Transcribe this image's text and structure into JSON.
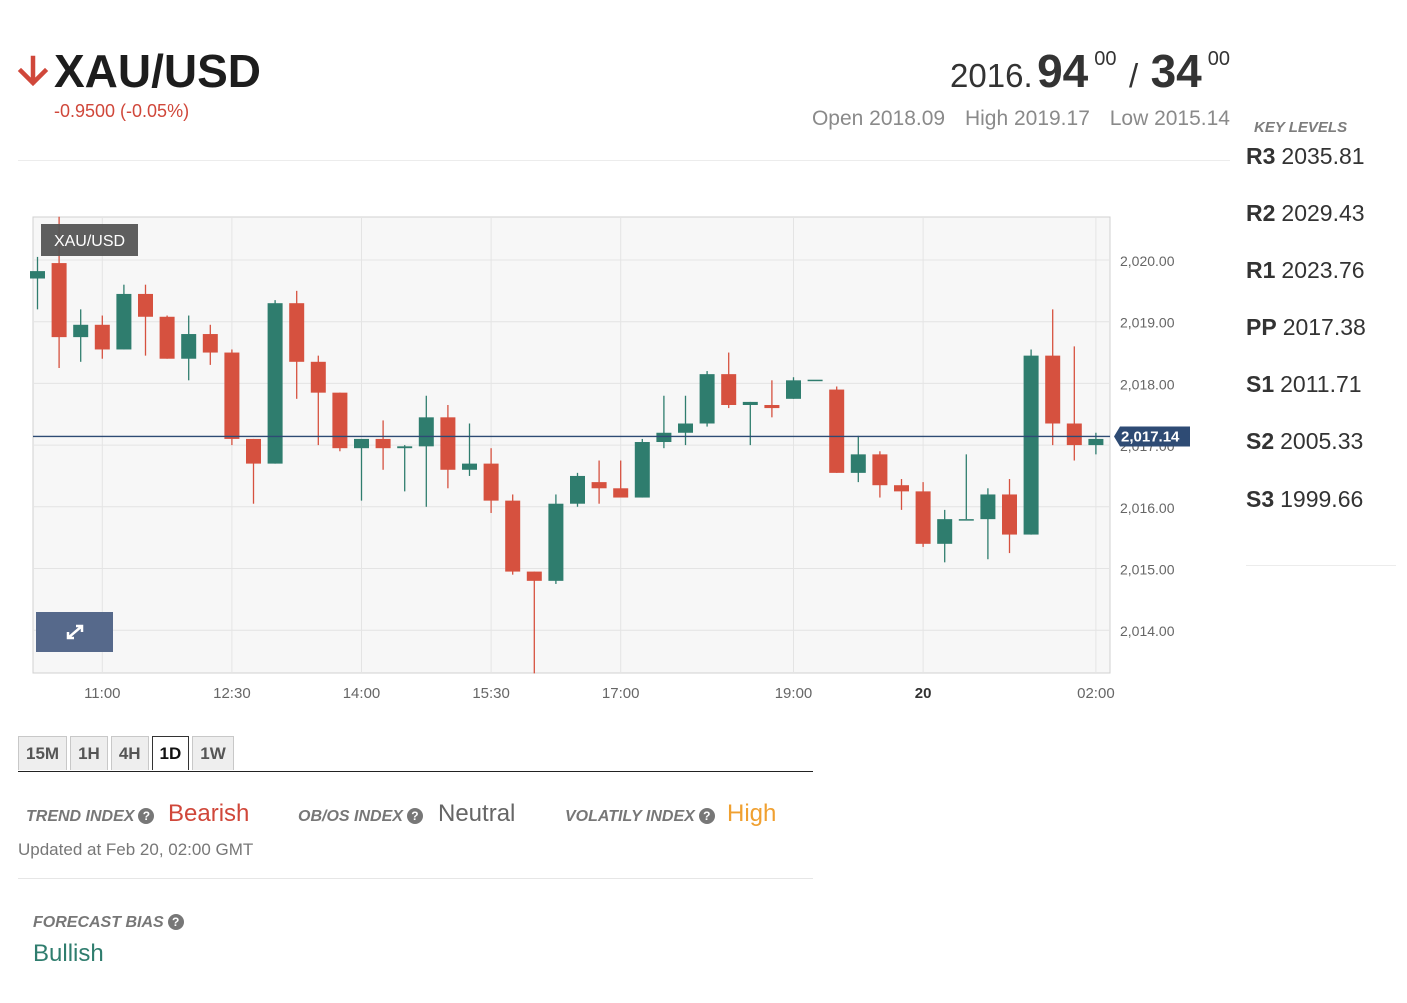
{
  "header": {
    "symbol": "XAU/USD",
    "direction_icon": "arrow-down-icon",
    "change": "-0.9500 (-0.05%)",
    "price_int": "2016.",
    "bid_main": "94",
    "bid_sup": "00",
    "sep": "/",
    "ask_main": "34",
    "ask_sup": "00",
    "open": "Open 2018.09",
    "high": "High 2019.17",
    "low": "Low 2015.14"
  },
  "key_levels": {
    "title": "KEY LEVELS",
    "levels": [
      {
        "name": "R3",
        "value": "2035.81"
      },
      {
        "name": "R2",
        "value": "2029.43"
      },
      {
        "name": "R1",
        "value": "2023.76"
      },
      {
        "name": "PP",
        "value": "2017.38"
      },
      {
        "name": "S1",
        "value": "2011.71"
      },
      {
        "name": "S2",
        "value": "2005.33"
      },
      {
        "name": "S3",
        "value": "1999.66"
      }
    ]
  },
  "colors": {
    "up": "#2f7d6e",
    "down": "#d6513f",
    "accent_red": "#d0473a",
    "neutral": "#555555",
    "high": "#f0a030",
    "price_tag": "#2e4b74"
  },
  "chart_data": {
    "type": "candlestick",
    "title": "XAU/USD",
    "ylim": [
      2013.3,
      2020.75
    ],
    "y_ticks": [
      "2,020.00",
      "2,019.00",
      "2,018.00",
      "2,017.00",
      "2,016.00",
      "2,015.00",
      "2,014.00"
    ],
    "y_tick_values": [
      2020,
      2019,
      2018,
      2017,
      2016,
      2015,
      2014
    ],
    "x_tick_labels": [
      "11:00",
      "12:30",
      "14:00",
      "15:30",
      "17:00",
      "19:00",
      "20",
      "02:00"
    ],
    "x_tick_index": [
      3,
      9,
      15,
      21,
      27,
      35,
      41,
      49
    ],
    "x_tick_bold": [
      false,
      false,
      false,
      false,
      false,
      false,
      true,
      false
    ],
    "current_price": 2017.14,
    "current_price_label": "2,017.14",
    "candles": [
      {
        "o": 2019.7,
        "h": 2020.05,
        "l": 2019.2,
        "c": 2019.82
      },
      {
        "o": 2019.95,
        "h": 2020.7,
        "l": 2018.25,
        "c": 2018.75
      },
      {
        "o": 2018.75,
        "h": 2019.2,
        "l": 2018.35,
        "c": 2018.95
      },
      {
        "o": 2018.95,
        "h": 2019.1,
        "l": 2018.4,
        "c": 2018.55
      },
      {
        "o": 2018.55,
        "h": 2019.6,
        "l": 2018.55,
        "c": 2019.45
      },
      {
        "o": 2019.45,
        "h": 2019.6,
        "l": 2018.45,
        "c": 2019.08
      },
      {
        "o": 2019.08,
        "h": 2019.1,
        "l": 2018.4,
        "c": 2018.4
      },
      {
        "o": 2018.4,
        "h": 2019.1,
        "l": 2018.05,
        "c": 2018.8
      },
      {
        "o": 2018.8,
        "h": 2018.95,
        "l": 2018.3,
        "c": 2018.5
      },
      {
        "o": 2018.5,
        "h": 2018.55,
        "l": 2017.0,
        "c": 2017.1
      },
      {
        "o": 2017.1,
        "h": 2017.1,
        "l": 2016.05,
        "c": 2016.7
      },
      {
        "o": 2016.7,
        "h": 2019.35,
        "l": 2016.7,
        "c": 2019.3
      },
      {
        "o": 2019.3,
        "h": 2019.5,
        "l": 2017.75,
        "c": 2018.35
      },
      {
        "o": 2018.35,
        "h": 2018.45,
        "l": 2017.0,
        "c": 2017.85
      },
      {
        "o": 2017.85,
        "h": 2017.85,
        "l": 2016.9,
        "c": 2016.95
      },
      {
        "o": 2016.95,
        "h": 2017.1,
        "l": 2016.1,
        "c": 2017.1
      },
      {
        "o": 2017.1,
        "h": 2017.4,
        "l": 2016.6,
        "c": 2016.95
      },
      {
        "o": 2016.95,
        "h": 2017.0,
        "l": 2016.25,
        "c": 2016.98
      },
      {
        "o": 2016.98,
        "h": 2017.8,
        "l": 2016.0,
        "c": 2017.45
      },
      {
        "o": 2017.45,
        "h": 2017.65,
        "l": 2016.3,
        "c": 2016.6
      },
      {
        "o": 2016.6,
        "h": 2017.35,
        "l": 2016.5,
        "c": 2016.7
      },
      {
        "o": 2016.7,
        "h": 2016.95,
        "l": 2015.9,
        "c": 2016.1
      },
      {
        "o": 2016.1,
        "h": 2016.2,
        "l": 2014.9,
        "c": 2014.95
      },
      {
        "o": 2014.95,
        "h": 2014.95,
        "l": 2013.3,
        "c": 2014.8
      },
      {
        "o": 2014.8,
        "h": 2016.2,
        "l": 2014.75,
        "c": 2016.05
      },
      {
        "o": 2016.05,
        "h": 2016.55,
        "l": 2016.0,
        "c": 2016.5
      },
      {
        "o": 2016.4,
        "h": 2016.75,
        "l": 2016.05,
        "c": 2016.3
      },
      {
        "o": 2016.3,
        "h": 2016.75,
        "l": 2016.2,
        "c": 2016.15
      },
      {
        "o": 2016.15,
        "h": 2017.1,
        "l": 2016.15,
        "c": 2017.05
      },
      {
        "o": 2017.05,
        "h": 2017.8,
        "l": 2016.95,
        "c": 2017.2
      },
      {
        "o": 2017.2,
        "h": 2017.8,
        "l": 2017.0,
        "c": 2017.35
      },
      {
        "o": 2017.35,
        "h": 2018.2,
        "l": 2017.3,
        "c": 2018.15
      },
      {
        "o": 2018.15,
        "h": 2018.5,
        "l": 2017.6,
        "c": 2017.65
      },
      {
        "o": 2017.65,
        "h": 2017.7,
        "l": 2017.0,
        "c": 2017.7
      },
      {
        "o": 2017.65,
        "h": 2018.05,
        "l": 2017.45,
        "c": 2017.6
      },
      {
        "o": 2017.75,
        "h": 2018.1,
        "l": 2017.75,
        "c": 2018.05
      },
      {
        "o": 2018.05,
        "h": 2018.05,
        "l": 2018.05,
        "c": 2018.06
      },
      {
        "o": 2017.9,
        "h": 2017.95,
        "l": 2016.55,
        "c": 2016.55
      },
      {
        "o": 2016.55,
        "h": 2017.15,
        "l": 2016.4,
        "c": 2016.85
      },
      {
        "o": 2016.85,
        "h": 2016.9,
        "l": 2016.15,
        "c": 2016.35
      },
      {
        "o": 2016.35,
        "h": 2016.45,
        "l": 2015.95,
        "c": 2016.25
      },
      {
        "o": 2016.25,
        "h": 2016.4,
        "l": 2015.35,
        "c": 2015.4
      },
      {
        "o": 2015.4,
        "h": 2015.95,
        "l": 2015.1,
        "c": 2015.8
      },
      {
        "o": 2015.8,
        "h": 2016.85,
        "l": 2015.8,
        "c": 2015.8
      },
      {
        "o": 2015.8,
        "h": 2016.3,
        "l": 2015.15,
        "c": 2016.2
      },
      {
        "o": 2016.2,
        "h": 2016.45,
        "l": 2015.25,
        "c": 2015.55
      },
      {
        "o": 2015.55,
        "h": 2018.55,
        "l": 2015.55,
        "c": 2018.45
      },
      {
        "o": 2018.45,
        "h": 2019.2,
        "l": 2017.0,
        "c": 2017.35
      },
      {
        "o": 2017.35,
        "h": 2018.6,
        "l": 2016.75,
        "c": 2017.0
      },
      {
        "o": 2017.0,
        "h": 2017.2,
        "l": 2016.85,
        "c": 2017.1
      }
    ]
  },
  "tabs": [
    "15M",
    "1H",
    "4H",
    "1D",
    "1W"
  ],
  "active_tab": "1D",
  "indices": {
    "trend_label": "TREND INDEX",
    "trend_value": "Bearish",
    "obos_label": "OB/OS INDEX",
    "obos_value": "Neutral",
    "vol_label": "VOLATILY INDEX",
    "vol_value": "High",
    "help_glyph": "?"
  },
  "updated": "Updated at Feb 20, 02:00 GMT",
  "forecast": {
    "label": "FORECAST BIAS",
    "value": "Bullish"
  }
}
